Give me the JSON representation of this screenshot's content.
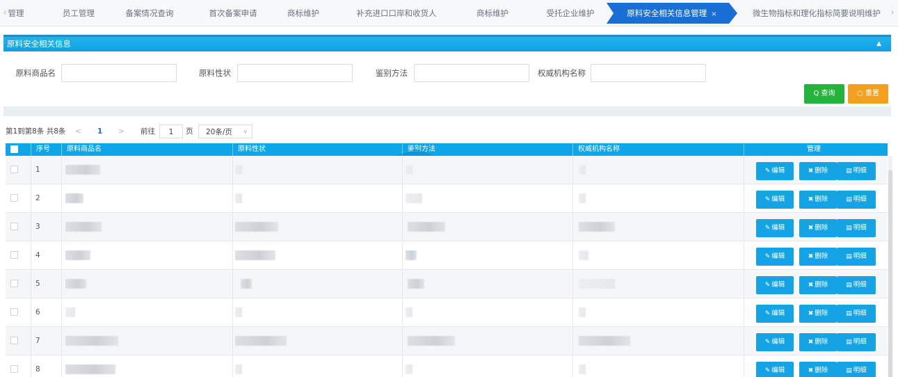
{
  "tabs": {
    "items": [
      {
        "label": "管理"
      },
      {
        "label": "员工管理"
      },
      {
        "label": "备案情况查询"
      },
      {
        "label": "首次备案申请"
      },
      {
        "label": "商标维护"
      },
      {
        "label": "补充进口口岸和收货人"
      },
      {
        "label": "商标维护"
      },
      {
        "label": "受托企业维护"
      },
      {
        "label": "原料安全相关信息管理",
        "active": true,
        "close": "×"
      },
      {
        "label": "微生物指标和理化指标简要说明维护"
      }
    ],
    "prev_glyph": "‹",
    "next_glyph": "›"
  },
  "panel": {
    "title": "原料安全相关信息",
    "collapse_glyph": "▲"
  },
  "search": {
    "fields": [
      {
        "label": "原料商品名",
        "value": ""
      },
      {
        "label": "原料性状",
        "value": ""
      },
      {
        "label": "鉴别方法",
        "value": ""
      },
      {
        "label": "权威机构名称",
        "value": ""
      }
    ],
    "query_label": "Q 查询",
    "reset_label": "○ 重置"
  },
  "pager": {
    "summary": "第1到第8条 共8条",
    "prev": "<",
    "current_page": "1",
    "next": ">",
    "goto_label": "前往",
    "goto_value": "1",
    "page_unit": "页",
    "page_size": "20条/页",
    "page_size_caret": "∨"
  },
  "table": {
    "headers": [
      "序号",
      "原料商品名",
      "原料性状",
      "鉴别方法",
      "权威机构名称",
      "管理"
    ],
    "actions": {
      "edit": "编辑",
      "delete": "删除",
      "detail": "明细",
      "edit_icon": "edit-icon",
      "delete_icon": "x-icon",
      "detail_icon": "list-icon"
    },
    "rows": [
      {
        "index": "1"
      },
      {
        "index": "2"
      },
      {
        "index": "3"
      },
      {
        "index": "4"
      },
      {
        "index": "5"
      },
      {
        "index": "6"
      },
      {
        "index": "7"
      },
      {
        "index": "8"
      }
    ]
  },
  "colors": {
    "accent": "#0ea5e9",
    "tab_active": "#1a6fd6",
    "query_button": "#25b33e",
    "reset_button": "#f2a022"
  }
}
